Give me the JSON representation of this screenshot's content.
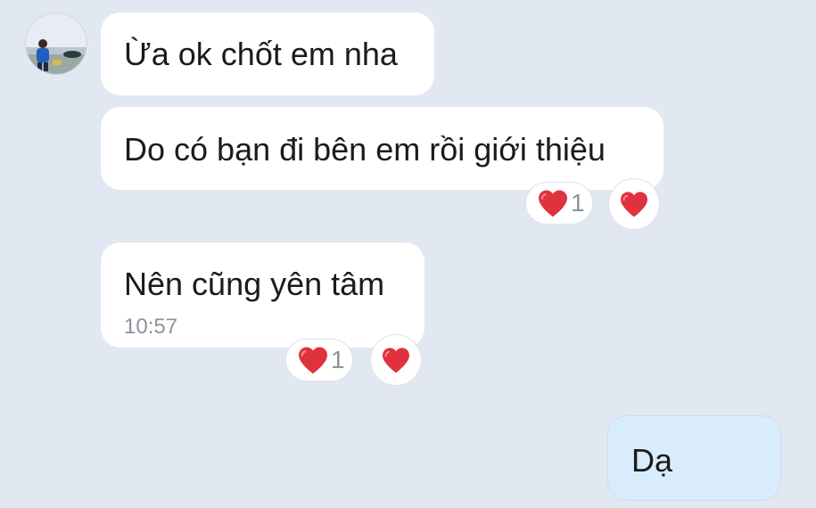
{
  "conversation": {
    "messages": [
      {
        "text": "Ừa ok chốt em nha",
        "sender": "other"
      },
      {
        "text": "Do có bạn đi bên em rồi giới thiệu",
        "sender": "other",
        "reaction": {
          "icon": "heart-icon",
          "count": "1"
        }
      },
      {
        "text": "Nên cũng yên tâm",
        "sender": "other",
        "time": "10:57",
        "reaction": {
          "icon": "heart-icon",
          "count": "1"
        }
      },
      {
        "text": "Dạ",
        "sender": "me"
      }
    ]
  },
  "colors": {
    "background": "#e2e8f1",
    "incoming_bubble": "#ffffff",
    "outgoing_bubble": "#d9ecfc",
    "heart": "#e0313f",
    "timestamp": "#8c939b"
  }
}
